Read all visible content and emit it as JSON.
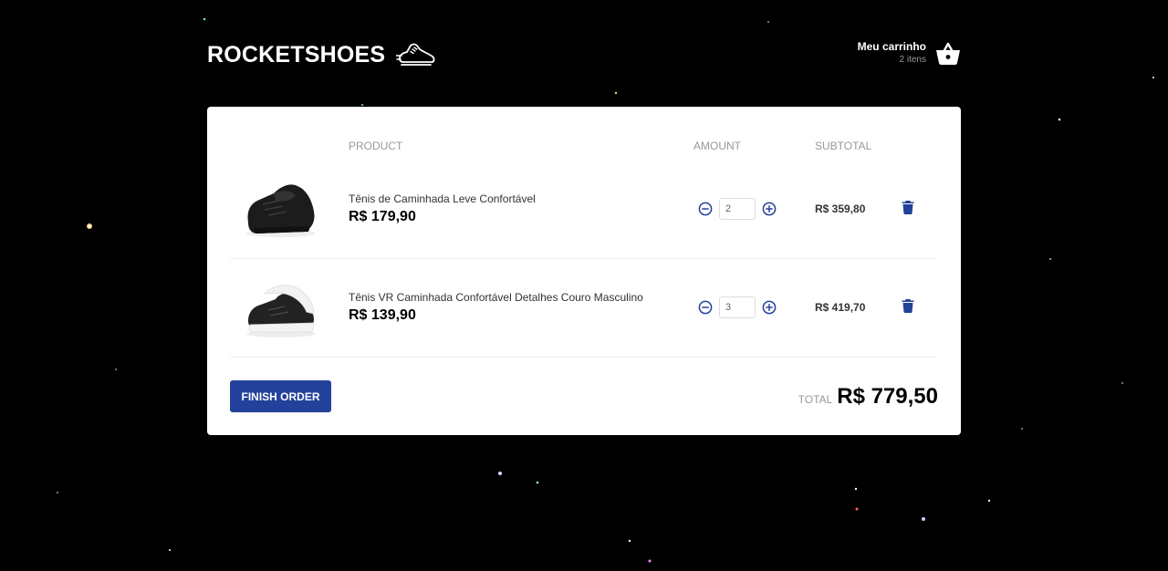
{
  "header": {
    "logo_text": "ROCKETSHOES",
    "logo_icon": "sneaker-icon",
    "cart_title": "Meu carrinho",
    "cart_count": "2 itens",
    "cart_icon": "basket-icon"
  },
  "table": {
    "col_product": "PRODUCT",
    "col_amount": "AMOUNT",
    "col_subtotal": "SUBTOTAL"
  },
  "items": [
    {
      "name": "Tênis de Caminhada Leve Confortável",
      "price": "R$ 179,90",
      "amount": "2",
      "subtotal": "R$ 359,80",
      "image": "black-sneaker"
    },
    {
      "name": "Tênis VR Caminhada Confortável Detalhes Couro Masculino",
      "price": "R$ 139,90",
      "amount": "3",
      "subtotal": "R$ 419,70",
      "image": "black-white-sneaker"
    }
  ],
  "footer": {
    "finish_label": "FINISH ORDER",
    "total_label": "TOTAL",
    "total_value": "R$ 779,50"
  },
  "colors": {
    "background": "#000000",
    "accent": "#23419a",
    "card": "#ffffff"
  }
}
